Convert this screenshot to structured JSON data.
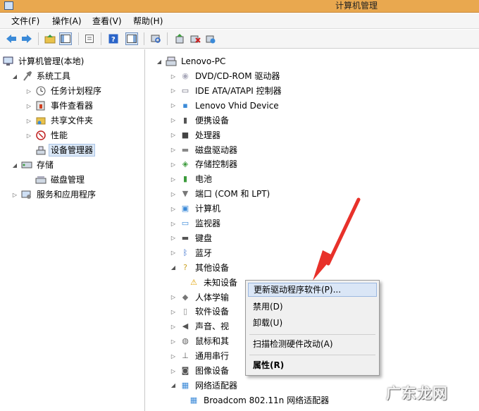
{
  "window": {
    "title": "计算机管理"
  },
  "menu": [
    "文件(F)",
    "操作(A)",
    "查看(V)",
    "帮助(H)"
  ],
  "toolbar": {
    "buttons": [
      "back-icon",
      "forward-icon",
      "up-folder-icon",
      "console-tree-icon",
      "export-list-icon",
      "help-icon",
      "show-hide-pane-icon",
      "scan-hardware-icon",
      "update-driver-icon",
      "disable-device-icon",
      "uninstall-device-icon"
    ]
  },
  "left_tree": [
    {
      "label": "计算机管理(本地)",
      "icon": "computer-management-icon",
      "expander": ""
    },
    {
      "label": "系统工具",
      "icon": "system-tools-icon",
      "expander": "◢"
    },
    {
      "label": "任务计划程序",
      "icon": "clock-icon",
      "expander": "▷"
    },
    {
      "label": "事件查看器",
      "icon": "event-viewer-icon",
      "expander": "▷"
    },
    {
      "label": "共享文件夹",
      "icon": "shared-folder-icon",
      "expander": "▷"
    },
    {
      "label": "性能",
      "icon": "performance-icon",
      "expander": "▷"
    },
    {
      "label": "设备管理器",
      "icon": "device-manager-icon",
      "expander": ""
    },
    {
      "label": "存储",
      "icon": "storage-icon",
      "expander": "◢"
    },
    {
      "label": "磁盘管理",
      "icon": "disk-management-icon",
      "expander": ""
    },
    {
      "label": "服务和应用程序",
      "icon": "services-icon",
      "expander": "▷"
    }
  ],
  "device_tree": {
    "root": "Lenovo-PC",
    "nodes": [
      {
        "label": "DVD/CD-ROM 驱动器",
        "icon": "dvd-drive-icon",
        "expander": "▷"
      },
      {
        "label": "IDE ATA/ATAPI 控制器",
        "icon": "ide-controller-icon",
        "expander": "▷"
      },
      {
        "label": "Lenovo Vhid Device",
        "icon": "vhid-device-icon",
        "expander": "▷"
      },
      {
        "label": "便携设备",
        "icon": "portable-device-icon",
        "expander": "▷"
      },
      {
        "label": "处理器",
        "icon": "processor-icon",
        "expander": "▷"
      },
      {
        "label": "磁盘驱动器",
        "icon": "disk-drive-icon",
        "expander": "▷"
      },
      {
        "label": "存储控制器",
        "icon": "storage-controller-icon",
        "expander": "▷"
      },
      {
        "label": "电池",
        "icon": "battery-icon",
        "expander": "▷"
      },
      {
        "label": "端口 (COM 和 LPT)",
        "icon": "port-icon",
        "expander": "▷"
      },
      {
        "label": "计算机",
        "icon": "computer-icon",
        "expander": "▷"
      },
      {
        "label": "监视器",
        "icon": "monitor-icon",
        "expander": "▷"
      },
      {
        "label": "键盘",
        "icon": "keyboard-icon",
        "expander": "▷"
      },
      {
        "label": "蓝牙",
        "icon": "bluetooth-icon",
        "expander": "▷"
      },
      {
        "label": "其他设备",
        "icon": "other-devices-icon",
        "expander": "◢"
      },
      {
        "label": "未知设备",
        "icon": "unknown-device-warning-icon",
        "expander": "",
        "child": true
      },
      {
        "label": "人体学输",
        "icon": "hid-icon",
        "expander": "▷"
      },
      {
        "label": "软件设备",
        "icon": "software-device-icon",
        "expander": "▷"
      },
      {
        "label": "声音、视",
        "icon": "sound-icon",
        "expander": "▷"
      },
      {
        "label": "鼠标和其",
        "icon": "mouse-icon",
        "expander": "▷"
      },
      {
        "label": "通用串行",
        "icon": "usb-icon",
        "expander": "▷"
      },
      {
        "label": "图像设备",
        "icon": "imaging-device-icon",
        "expander": "▷"
      },
      {
        "label": "网络适配器",
        "icon": "network-adapter-icon",
        "expander": "◢"
      },
      {
        "label": "Broadcom 802.11n 网络适配器",
        "icon": "network-card-icon",
        "expander": "",
        "child": true
      }
    ]
  },
  "context_menu": {
    "items": [
      "更新驱动程序软件(P)...",
      "禁用(D)",
      "卸载(U)",
      "扫描检测硬件改动(A)",
      "属性(R)"
    ]
  },
  "watermark": "广东龙网",
  "colors": {
    "titlebar": "#e9a84f",
    "arrow": "#e8312a",
    "selection": "#dbe8f7"
  }
}
